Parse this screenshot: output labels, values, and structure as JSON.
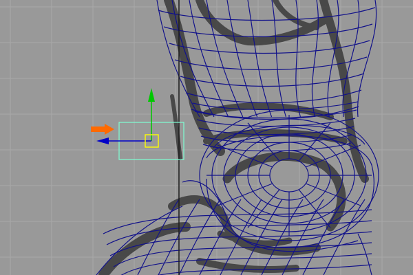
{
  "viewport": {
    "background": "#999999",
    "grid_color": "#a9a9a9",
    "grid_axis_color": "#1c1c1c"
  },
  "wireframe": {
    "color": "#12128a",
    "reference_image_color": "#3a3a3a"
  },
  "manipulator": {
    "type": "move",
    "x_axis_color": "#0000c8",
    "y_axis_color": "#00c800",
    "z_axis_color": "#ff6a00",
    "center_handle_color": "#ffff00",
    "selection_box_color": "#7fffd4"
  },
  "icons": {
    "move_tool": "move-manipulator-icon"
  }
}
